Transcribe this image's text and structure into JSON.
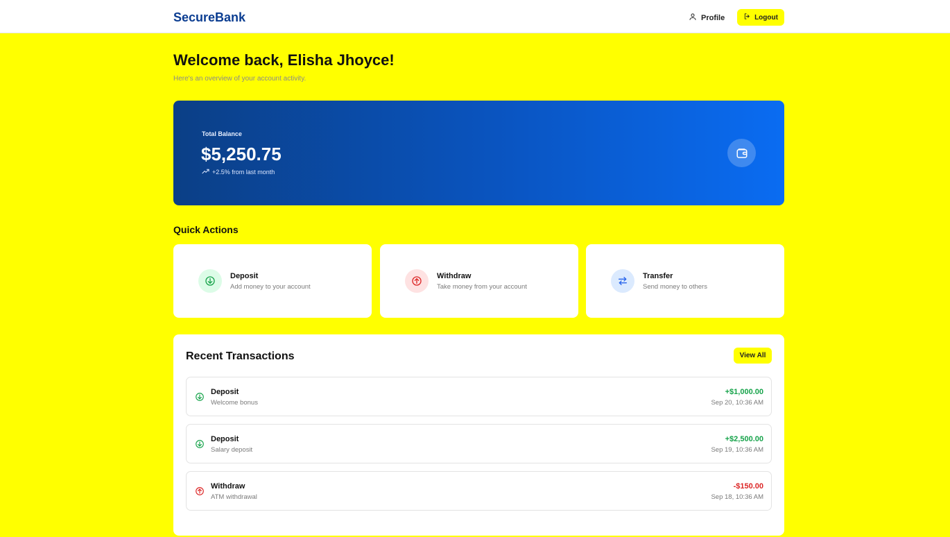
{
  "nav": {
    "brand": "SecureBank",
    "profile_label": "Profile",
    "logout_label": "Logout"
  },
  "header": {
    "welcome": "Welcome back, Elisha Jhoyce!",
    "subtitle": "Here's an overview of your account activity."
  },
  "balance": {
    "label": "Total Balance",
    "amount": "$5,250.75",
    "change": "+2.5% from last month",
    "icon": "wallet-icon"
  },
  "quick_actions": {
    "title": "Quick Actions",
    "items": [
      {
        "title": "Deposit",
        "description": "Add money to your account",
        "icon": "arrow-down-circle-icon",
        "color": "#16a34a",
        "bg": "#dcfce7"
      },
      {
        "title": "Withdraw",
        "description": "Take money from your account",
        "icon": "arrow-up-circle-icon",
        "color": "#dc2626",
        "bg": "#fee2e2"
      },
      {
        "title": "Transfer",
        "description": "Send money to others",
        "icon": "transfer-arrows-icon",
        "color": "#2563eb",
        "bg": "#dbeafe"
      }
    ]
  },
  "transactions": {
    "title": "Recent Transactions",
    "view_all_label": "View All",
    "items": [
      {
        "type": "Deposit",
        "description": "Welcome bonus",
        "amount": "+$1,000.00",
        "date": "Sep 20, 10:36 AM",
        "direction": "in"
      },
      {
        "type": "Deposit",
        "description": "Salary deposit",
        "amount": "+$2,500.00",
        "date": "Sep 19, 10:36 AM",
        "direction": "in"
      },
      {
        "type": "Withdraw",
        "description": "ATM withdrawal",
        "amount": "-$150.00",
        "date": "Sep 18, 10:36 AM",
        "direction": "out"
      }
    ]
  },
  "colors": {
    "accent": "#ffff00",
    "brand": "#0b3d91",
    "positive": "#16a34a",
    "negative": "#dc2626"
  }
}
